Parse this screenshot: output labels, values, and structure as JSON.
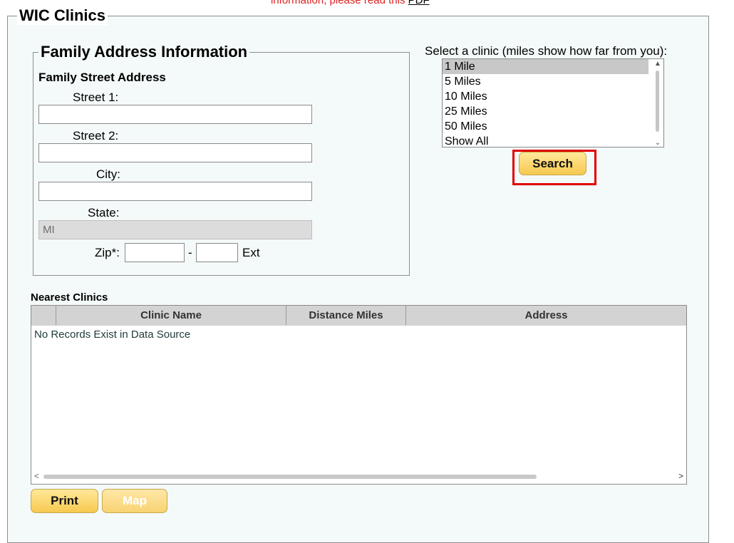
{
  "notice": {
    "text": "information, please read this ",
    "link": "PDF"
  },
  "main": {
    "legend": "WIC Clinics"
  },
  "family": {
    "legend": "Family Address Information",
    "street_heading": "Family Street Address",
    "street1_label": "Street 1:",
    "street1_value": "",
    "street2_label": "Street 2:",
    "street2_value": "",
    "city_label": "City:",
    "city_value": "",
    "state_label": "State:",
    "state_value": "MI",
    "zip_label": "Zip*:",
    "zip_value": "",
    "zip_sep": "-",
    "zip_ext_value": "",
    "ext_label": "Ext"
  },
  "clinic_select": {
    "prompt": "Select a clinic (miles show how far from you):",
    "options": [
      "1 Mile",
      "5 Miles",
      "10 Miles",
      "25 Miles",
      "50 Miles",
      "Show All"
    ],
    "selected": "1 Mile",
    "search_label": "Search"
  },
  "nearest": {
    "title": "Nearest Clinics",
    "columns": [
      "Clinic Name",
      "Distance Miles",
      "Address"
    ],
    "empty_text": "No Records Exist in Data Source"
  },
  "actions": {
    "print_label": "Print",
    "map_label": "Map"
  },
  "colors": {
    "highlight": "#e00000",
    "button": "#f7c94f",
    "panel_bg": "#f4faf9"
  }
}
